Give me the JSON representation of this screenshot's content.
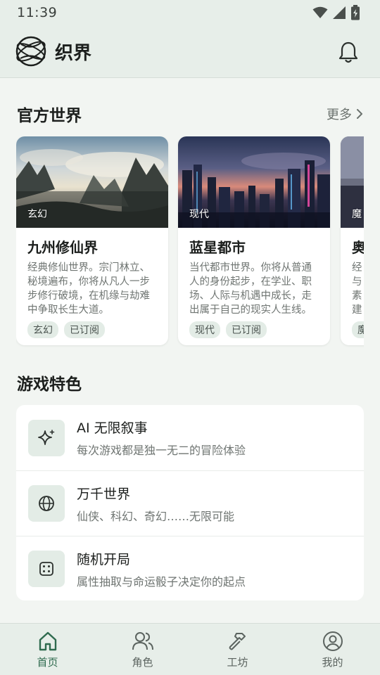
{
  "status_bar": {
    "time": "11:39"
  },
  "app_bar": {
    "title": "织界",
    "logo_icon": "globe-logo-icon",
    "notification_icon": "bell-icon"
  },
  "worlds_section": {
    "title": "官方世界",
    "more_label": "更多",
    "cards": [
      {
        "tag": "玄幻",
        "name": "九州修仙界",
        "description": "经典修仙世界。宗门林立、秘境遍布，你将从凡人一步步修行破境，在机缘与劫难中争取长生大道。",
        "chips": [
          "玄幻",
          "已订阅"
        ]
      },
      {
        "tag": "现代",
        "name": "蓝星都市",
        "description": "当代都市世界。你将从普通人的身份起步，在学业、职场、人际与机遇中成长，走出属于自己的现实人生线。",
        "chips": [
          "现代",
          "已订阅"
        ]
      },
      {
        "tag": "魔",
        "name": "奥",
        "description": "经\n与\n素\n建",
        "chips": [
          "魔"
        ]
      }
    ]
  },
  "features_section": {
    "title": "游戏特色",
    "items": [
      {
        "icon": "sparkle-icon",
        "title": "AI 无限叙事",
        "subtitle": "每次游戏都是独一无二的冒险体验"
      },
      {
        "icon": "globe-icon",
        "title": "万千世界",
        "subtitle": "仙侠、科幻、奇幻……无限可能"
      },
      {
        "icon": "dice-icon",
        "title": "随机开局",
        "subtitle": "属性抽取与命运骰子决定你的起点"
      }
    ]
  },
  "bottom_nav": {
    "items": [
      {
        "label": "首页",
        "icon": "home-icon",
        "active": true
      },
      {
        "label": "角色",
        "icon": "people-icon",
        "active": false
      },
      {
        "label": "工坊",
        "icon": "hammer-icon",
        "active": false
      },
      {
        "label": "我的",
        "icon": "account-icon",
        "active": false
      }
    ]
  },
  "colors": {
    "accent": "#2f6b4f",
    "background": "#f2f5f2",
    "bar": "#e7eee9",
    "chip": "#e3ece6"
  }
}
